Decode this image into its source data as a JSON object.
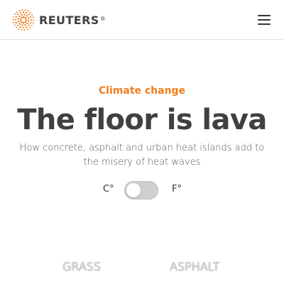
{
  "header": {
    "logo_text": "REUTERS",
    "logo_reg": "®",
    "logo_icon": "reuters-dot-logo-icon",
    "menu_icon": "hamburger-menu-icon"
  },
  "article": {
    "kicker": "Climate change",
    "headline": "The floor is lava",
    "dek": "How concrete, asphalt and urban heat islands add to the misery of heat waves"
  },
  "unit_toggle": {
    "celsius_label": "C°",
    "fahrenheit_label": "F°",
    "selected": "C°"
  },
  "surfaces": {
    "grass_label": "GRASS",
    "asphalt_label": "ASPHALT"
  },
  "colors": {
    "accent": "#f07c1c",
    "headline": "#404040",
    "toggle_track": "#cfcfcf"
  }
}
